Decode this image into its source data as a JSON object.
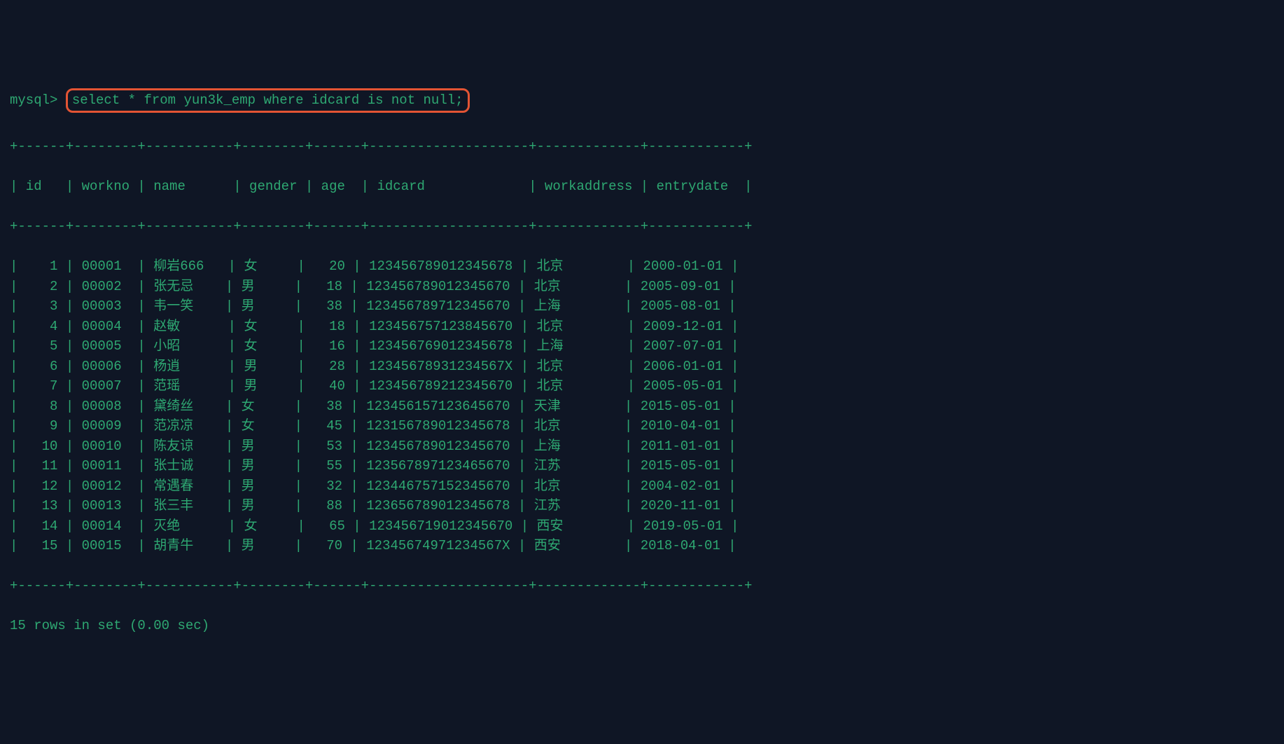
{
  "prompt": "mysql> ",
  "query": "select * from yun3k_emp where idcard is not null;",
  "border_top": "+------+--------+-----------+--------+------+--------------------+-------------+------------+",
  "header": "| id   | workno | name      | gender | age  | idcard             | workaddress | entrydate  |",
  "border_mid": "+------+--------+-----------+--------+------+--------------------+-------------+------------+",
  "rows": [
    "|    1 | 00001  | 柳岩666   | 女     |   20 | 123456789012345678 | 北京        | 2000-01-01 |",
    "|    2 | 00002  | 张无忌    | 男     |   18 | 123456789012345670 | 北京        | 2005-09-01 |",
    "|    3 | 00003  | 韦一笑    | 男     |   38 | 123456789712345670 | 上海        | 2005-08-01 |",
    "|    4 | 00004  | 赵敏      | 女     |   18 | 123456757123845670 | 北京        | 2009-12-01 |",
    "|    5 | 00005  | 小昭      | 女     |   16 | 123456769012345678 | 上海        | 2007-07-01 |",
    "|    6 | 00006  | 杨逍      | 男     |   28 | 12345678931234567X | 北京        | 2006-01-01 |",
    "|    7 | 00007  | 范瑶      | 男     |   40 | 123456789212345670 | 北京        | 2005-05-01 |",
    "|    8 | 00008  | 黛绮丝    | 女     |   38 | 123456157123645670 | 天津        | 2015-05-01 |",
    "|    9 | 00009  | 范凉凉    | 女     |   45 | 123156789012345678 | 北京        | 2010-04-01 |",
    "|   10 | 00010  | 陈友谅    | 男     |   53 | 123456789012345670 | 上海        | 2011-01-01 |",
    "|   11 | 00011  | 张士诚    | 男     |   55 | 123567897123465670 | 江苏        | 2015-05-01 |",
    "|   12 | 00012  | 常遇春    | 男     |   32 | 123446757152345670 | 北京        | 2004-02-01 |",
    "|   13 | 00013  | 张三丰    | 男     |   88 | 123656789012345678 | 江苏        | 2020-11-01 |",
    "|   14 | 00014  | 灭绝      | 女     |   65 | 123456719012345670 | 西安        | 2019-05-01 |",
    "|   15 | 00015  | 胡青牛    | 男     |   70 | 12345674971234567X | 西安        | 2018-04-01 |"
  ],
  "border_bot": "+------+--------+-----------+--------+------+--------------------+-------------+------------+",
  "footer": "15 rows in set (0.00 sec)",
  "chart_data": {
    "type": "table",
    "columns": [
      "id",
      "workno",
      "name",
      "gender",
      "age",
      "idcard",
      "workaddress",
      "entrydate"
    ],
    "rows": [
      [
        1,
        "00001",
        "柳岩666",
        "女",
        20,
        "123456789012345678",
        "北京",
        "2000-01-01"
      ],
      [
        2,
        "00002",
        "张无忌",
        "男",
        18,
        "123456789012345670",
        "北京",
        "2005-09-01"
      ],
      [
        3,
        "00003",
        "韦一笑",
        "男",
        38,
        "123456789712345670",
        "上海",
        "2005-08-01"
      ],
      [
        4,
        "00004",
        "赵敏",
        "女",
        18,
        "123456757123845670",
        "北京",
        "2009-12-01"
      ],
      [
        5,
        "00005",
        "小昭",
        "女",
        16,
        "123456769012345678",
        "上海",
        "2007-07-01"
      ],
      [
        6,
        "00006",
        "杨逍",
        "男",
        28,
        "12345678931234567X",
        "北京",
        "2006-01-01"
      ],
      [
        7,
        "00007",
        "范瑶",
        "男",
        40,
        "123456789212345670",
        "北京",
        "2005-05-01"
      ],
      [
        8,
        "00008",
        "黛绮丝",
        "女",
        38,
        "123456157123645670",
        "天津",
        "2015-05-01"
      ],
      [
        9,
        "00009",
        "范凉凉",
        "女",
        45,
        "123156789012345678",
        "北京",
        "2010-04-01"
      ],
      [
        10,
        "00010",
        "陈友谅",
        "男",
        53,
        "123456789012345670",
        "上海",
        "2011-01-01"
      ],
      [
        11,
        "00011",
        "张士诚",
        "男",
        55,
        "123567897123465670",
        "江苏",
        "2015-05-01"
      ],
      [
        12,
        "00012",
        "常遇春",
        "男",
        32,
        "123446757152345670",
        "北京",
        "2004-02-01"
      ],
      [
        13,
        "00013",
        "张三丰",
        "男",
        88,
        "123656789012345678",
        "江苏",
        "2020-11-01"
      ],
      [
        14,
        "00014",
        "灭绝",
        "女",
        65,
        "123456719012345670",
        "西安",
        "2019-05-01"
      ],
      [
        15,
        "00015",
        "胡青牛",
        "男",
        70,
        "12345674971234567X",
        "西安",
        "2018-04-01"
      ]
    ]
  }
}
